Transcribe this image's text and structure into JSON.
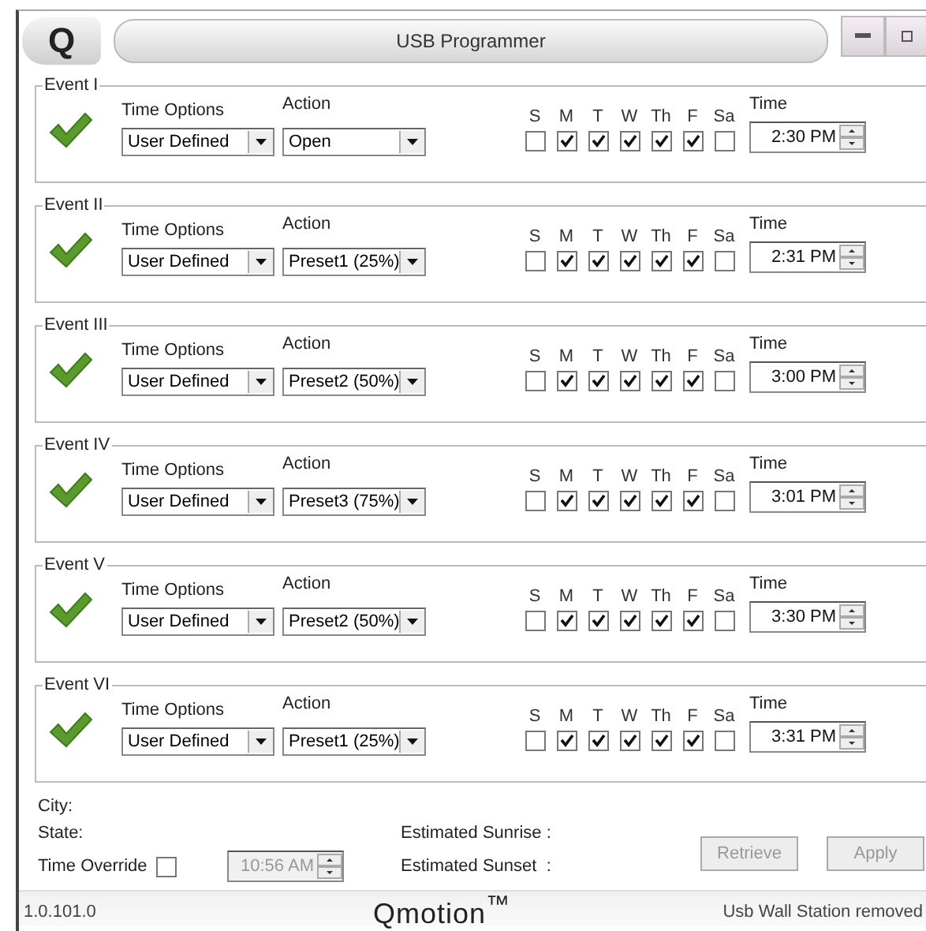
{
  "window": {
    "title": "USB Programmer",
    "logo_letter": "Q"
  },
  "events": [
    {
      "name": "Event I",
      "enabled": true,
      "time_options_label": "Time Options",
      "time_option": "User Defined",
      "action_label": "Action",
      "action": "Open",
      "time_label": "Time",
      "time": "2:30 PM",
      "days": [
        {
          "label": "S",
          "checked": false
        },
        {
          "label": "M",
          "checked": true
        },
        {
          "label": "T",
          "checked": true
        },
        {
          "label": "W",
          "checked": true
        },
        {
          "label": "Th",
          "checked": true
        },
        {
          "label": "F",
          "checked": true
        },
        {
          "label": "Sa",
          "checked": false
        }
      ]
    },
    {
      "name": "Event II",
      "enabled": true,
      "time_options_label": "Time Options",
      "time_option": "User Defined",
      "action_label": "Action",
      "action": "Preset1 (25%)",
      "time_label": "Time",
      "time": "2:31 PM",
      "days": [
        {
          "label": "S",
          "checked": false
        },
        {
          "label": "M",
          "checked": true
        },
        {
          "label": "T",
          "checked": true
        },
        {
          "label": "W",
          "checked": true
        },
        {
          "label": "Th",
          "checked": true
        },
        {
          "label": "F",
          "checked": true
        },
        {
          "label": "Sa",
          "checked": false
        }
      ]
    },
    {
      "name": "Event III",
      "enabled": true,
      "time_options_label": "Time Options",
      "time_option": "User Defined",
      "action_label": "Action",
      "action": "Preset2 (50%)",
      "time_label": "Time",
      "time": "3:00 PM",
      "days": [
        {
          "label": "S",
          "checked": false
        },
        {
          "label": "M",
          "checked": true
        },
        {
          "label": "T",
          "checked": true
        },
        {
          "label": "W",
          "checked": true
        },
        {
          "label": "Th",
          "checked": true
        },
        {
          "label": "F",
          "checked": true
        },
        {
          "label": "Sa",
          "checked": false
        }
      ]
    },
    {
      "name": "Event IV",
      "enabled": true,
      "time_options_label": "Time Options",
      "time_option": "User Defined",
      "action_label": "Action",
      "action": "Preset3 (75%)",
      "time_label": "Time",
      "time": "3:01 PM",
      "days": [
        {
          "label": "S",
          "checked": false
        },
        {
          "label": "M",
          "checked": true
        },
        {
          "label": "T",
          "checked": true
        },
        {
          "label": "W",
          "checked": true
        },
        {
          "label": "Th",
          "checked": true
        },
        {
          "label": "F",
          "checked": true
        },
        {
          "label": "Sa",
          "checked": false
        }
      ]
    },
    {
      "name": "Event V",
      "enabled": true,
      "time_options_label": "Time Options",
      "time_option": "User Defined",
      "action_label": "Action",
      "action": "Preset2 (50%)",
      "time_label": "Time",
      "time": "3:30 PM",
      "days": [
        {
          "label": "S",
          "checked": false
        },
        {
          "label": "M",
          "checked": true
        },
        {
          "label": "T",
          "checked": true
        },
        {
          "label": "W",
          "checked": true
        },
        {
          "label": "Th",
          "checked": true
        },
        {
          "label": "F",
          "checked": true
        },
        {
          "label": "Sa",
          "checked": false
        }
      ]
    },
    {
      "name": "Event VI",
      "enabled": true,
      "time_options_label": "Time Options",
      "time_option": "User Defined",
      "action_label": "Action",
      "action": "Preset1 (25%)",
      "time_label": "Time",
      "time": "3:31 PM",
      "days": [
        {
          "label": "S",
          "checked": false
        },
        {
          "label": "M",
          "checked": true
        },
        {
          "label": "T",
          "checked": true
        },
        {
          "label": "W",
          "checked": true
        },
        {
          "label": "Th",
          "checked": true
        },
        {
          "label": "F",
          "checked": true
        },
        {
          "label": "Sa",
          "checked": false
        }
      ]
    }
  ],
  "location": {
    "city_label": "City:",
    "state_label": "State:",
    "sunrise_label": "Estimated Sunrise :",
    "sunset_label": "Estimated Sunset  :"
  },
  "time_override": {
    "label": "Time Override",
    "checked": false,
    "value": "10:56 AM",
    "disabled": true
  },
  "buttons": [
    {
      "label": "Retrieve",
      "disabled": true
    },
    {
      "label": "Apply",
      "disabled": true
    }
  ],
  "status_bar": {
    "version": "1.0.101.0",
    "logo": "Qmotion$^{™}$",
    "message": "Usb Wall Station removed"
  }
}
